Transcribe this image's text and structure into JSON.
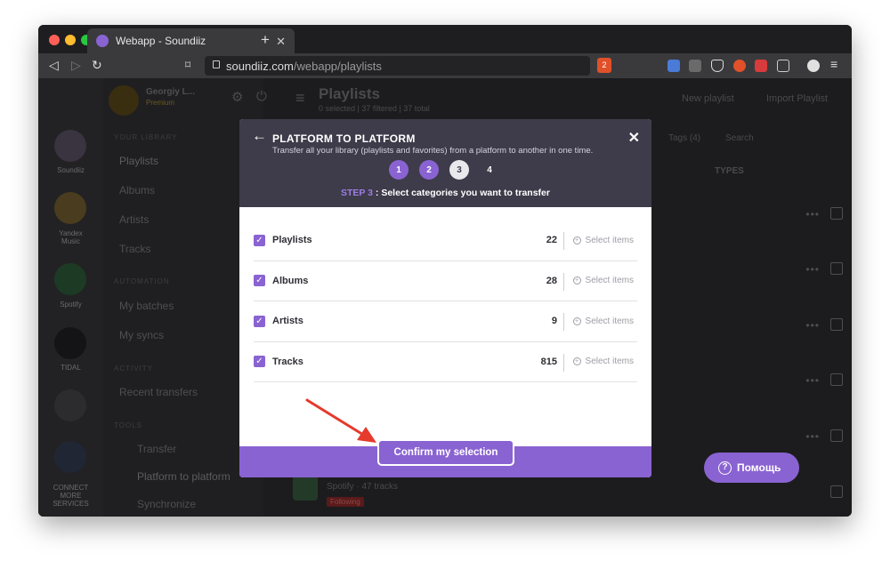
{
  "browser": {
    "tab_title": "Webapp - Soundiiz",
    "url_host": "soundiiz.com",
    "url_path": "/webapp/playlists",
    "brave_badge": "2"
  },
  "app": {
    "user_name": "Georgiy L...",
    "user_plan": "Premium",
    "page_title": "Playlists",
    "page_subtitle": "0 selected | 37 filtered | 37 total",
    "new_playlist": "New playlist",
    "import_playlist": "Import Playlist",
    "tags_filter": "Tags (4)",
    "search_placeholder": "Search",
    "types_header": "TYPES",
    "services": [
      {
        "label": "Soundiiz"
      },
      {
        "label": "Yandex Music"
      },
      {
        "label": "Spotify"
      },
      {
        "label": "TIDAL"
      }
    ],
    "connect_label": "CONNECT MORE SERVICES",
    "sidebar": {
      "heading_library": "YOUR LIBRARY",
      "playlists": "Playlists",
      "albums": "Albums",
      "artists": "Artists",
      "tracks": "Tracks",
      "heading_automation": "AUTOMATION",
      "batches": "My batches",
      "syncs": "My syncs",
      "heading_activity": "ACTIVITY",
      "recent": "Recent transfers",
      "heading_tools": "TOOLS",
      "transfer": "Transfer",
      "platform": "Platform to platform",
      "synchronize": "Synchronize"
    },
    "bg_row": {
      "service": "Spotify",
      "meta": "47 tracks",
      "badge": "Following"
    }
  },
  "modal": {
    "title": "PLATFORM TO PLATFORM",
    "subtitle": "Transfer all your library (playlists and favorites) from a platform to another in one time.",
    "steps": [
      "1",
      "2",
      "3",
      "4"
    ],
    "step_prefix": "STEP 3",
    "step_text": " : Select categories you want to transfer",
    "select_items_label": "Select items",
    "categories": [
      {
        "label": "Playlists",
        "count": "22"
      },
      {
        "label": "Albums",
        "count": "28"
      },
      {
        "label": "Artists",
        "count": "9"
      },
      {
        "label": "Tracks",
        "count": "815"
      }
    ],
    "confirm_label": "Confirm my selection"
  },
  "help": {
    "label": "Помощь"
  },
  "colors": {
    "accent": "#8a63d2",
    "header": "#3e3b4a",
    "arrow": "#e53a2c"
  }
}
